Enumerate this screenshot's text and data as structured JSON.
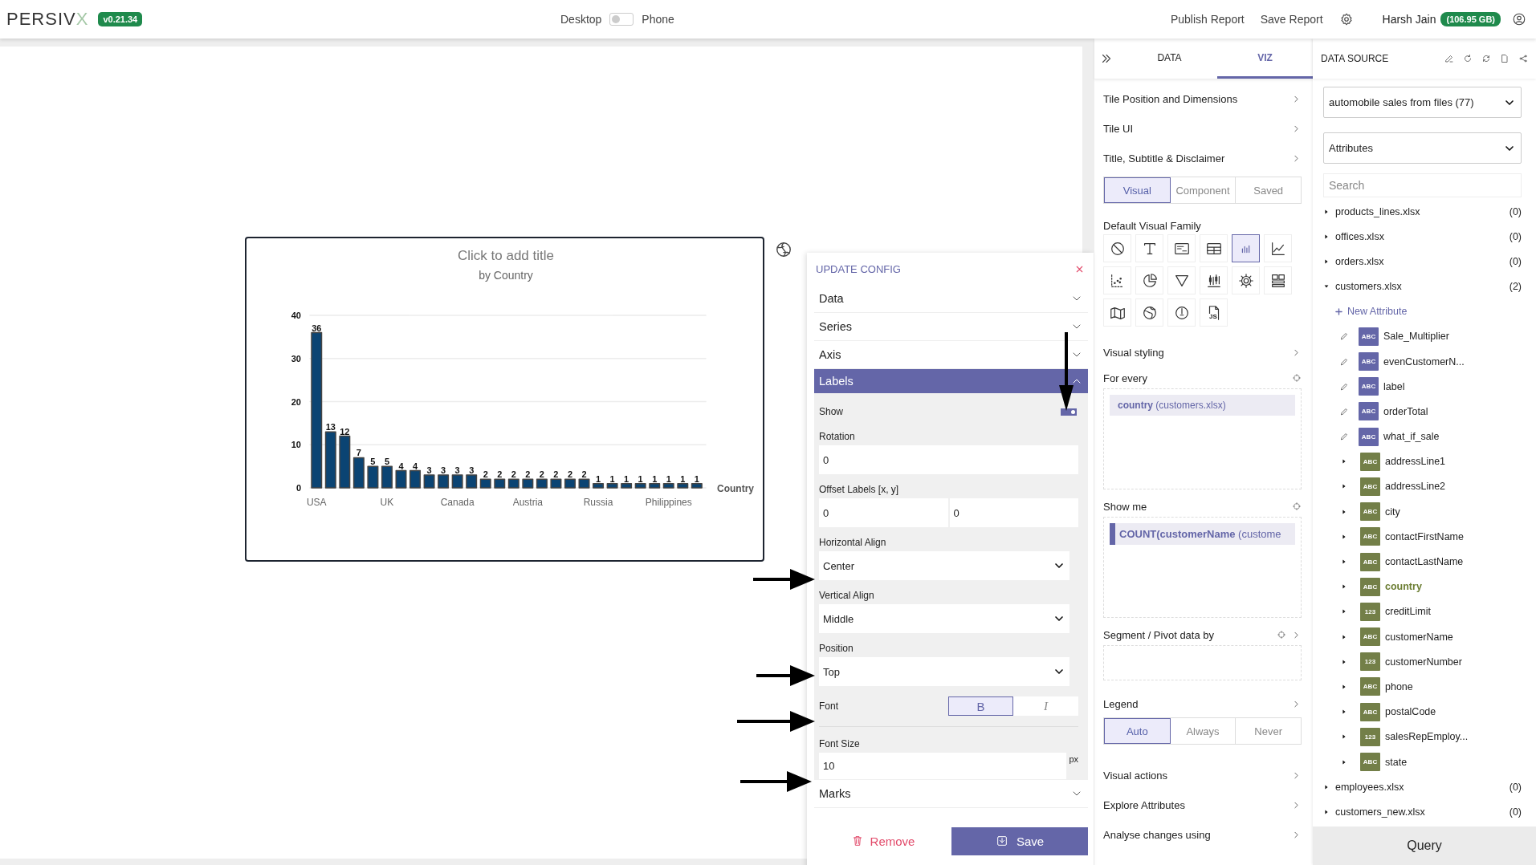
{
  "top_bar": {
    "logo": {
      "text": "PERSIV",
      "accent": "X"
    },
    "version": "v0.21.34",
    "view_toggle": {
      "left": "Desktop",
      "right": "Phone",
      "on": false
    },
    "actions": [
      "Publish Report",
      "Save Report"
    ],
    "user": {
      "name": "Harsh Jain",
      "storage": "(106.95 GB)"
    }
  },
  "tile": {
    "title": "Click to add title",
    "subtitle": "by Country",
    "chart_data": {
      "type": "bar",
      "xlabel": "Country",
      "categories": [
        "USA",
        null,
        null,
        null,
        null,
        "UK",
        null,
        null,
        null,
        null,
        "Canada",
        null,
        null,
        null,
        null,
        "Austria",
        null,
        null,
        null,
        null,
        "Russia",
        null,
        null,
        null,
        null,
        "Philippines",
        null,
        null
      ],
      "values": [
        36,
        13,
        12,
        7,
        5,
        5,
        4,
        4,
        3,
        3,
        3,
        3,
        2,
        2,
        2,
        2,
        2,
        2,
        2,
        2,
        1,
        1,
        1,
        1,
        1,
        1,
        1,
        1
      ],
      "grid": true,
      "ylim": [
        0,
        40
      ],
      "yticks": [
        0,
        10,
        20,
        30,
        40
      ],
      "data_labels": true
    }
  },
  "config": {
    "title": "UPDATE CONFIG",
    "sections": [
      {
        "label": "Data",
        "expanded": false
      },
      {
        "label": "Series",
        "expanded": false
      },
      {
        "label": "Axis",
        "expanded": false
      },
      {
        "label": "Labels",
        "expanded": true
      },
      {
        "label": "Marks",
        "expanded": false
      }
    ],
    "label_fields": [
      {
        "kind": "toggle",
        "label": "Show",
        "on": true
      },
      {
        "kind": "input",
        "label": "Rotation",
        "value": "0"
      },
      {
        "kind": "pair",
        "label": "Offset Labels [x, y]",
        "values": [
          "0",
          "0"
        ]
      },
      {
        "kind": "select",
        "label": "Horizontal Align",
        "value": "Center"
      },
      {
        "kind": "select",
        "label": "Vertical Align",
        "value": "Middle"
      },
      {
        "kind": "select",
        "label": "Position",
        "value": "Top"
      },
      {
        "kind": "style",
        "label": "Font",
        "options": [
          {
            "label": "B",
            "selected": true
          },
          {
            "label": "I",
            "selected": false
          }
        ]
      },
      {
        "kind": "size",
        "label": "Font Size",
        "value": "10",
        "unit": "px"
      }
    ],
    "remove": "Remove",
    "save": "Save"
  },
  "viz_panel": {
    "tabs": [
      {
        "label": "DATA",
        "selected": false
      },
      {
        "label": "VIZ",
        "selected": true
      }
    ],
    "links_top": [
      "Tile Position and Dimensions",
      "Tile UI",
      "Title, Subtitle & Disclaimer"
    ],
    "modes": [
      {
        "label": "Visual",
        "selected": true
      },
      {
        "label": "Component",
        "selected": false
      },
      {
        "label": "Saved",
        "selected": false
      }
    ],
    "family_label": "Default Visual Family",
    "family": [
      {
        "kind": "none",
        "selected": false
      },
      {
        "kind": "text",
        "selected": false
      },
      {
        "kind": "card",
        "selected": false
      },
      {
        "kind": "table",
        "selected": false
      },
      {
        "kind": "bar",
        "selected": true
      },
      {
        "kind": "line",
        "selected": false
      },
      {
        "kind": "scatter",
        "selected": false
      },
      {
        "kind": "pie",
        "selected": false
      },
      {
        "kind": "funnel",
        "selected": false
      },
      {
        "kind": "candle",
        "selected": false
      },
      {
        "kind": "gear",
        "selected": false
      },
      {
        "kind": "layout",
        "selected": false
      },
      {
        "kind": "map",
        "selected": false
      },
      {
        "kind": "globe",
        "selected": false
      },
      {
        "kind": "gauge",
        "selected": false
      },
      {
        "kind": "file",
        "selected": false,
        "label": "JS"
      }
    ],
    "styling": "Visual styling",
    "for_every": {
      "label": "For every",
      "chips": [
        "**country** (customers.xlsx)"
      ]
    },
    "show_me": {
      "label": "Show me",
      "chips": [
        "**COUNT(customerName** (custome"
      ]
    },
    "segment": {
      "label": "Segment / Pivot data by"
    },
    "legend": {
      "label": "Legend",
      "options": [
        {
          "label": "Auto",
          "selected": true
        },
        {
          "label": "Always",
          "selected": false
        },
        {
          "label": "Never",
          "selected": false
        }
      ]
    },
    "links_bottom": [
      "Visual actions",
      "Explore Attributes",
      "Analyse changes using"
    ]
  },
  "data_source": {
    "title": "DATA SOURCE",
    "dataset": "automobile sales from files (77)",
    "view": "Attributes",
    "search_placeholder": "Search",
    "files": [
      {
        "name": "products_lines.xlsx",
        "count": "(0)",
        "expanded": false
      },
      {
        "name": "offices.xlsx",
        "count": "(0)",
        "expanded": false
      },
      {
        "name": "orders.xlsx",
        "count": "(0)",
        "expanded": false
      },
      {
        "name": "customers.xlsx",
        "count": "(2)",
        "expanded": true,
        "new_attribute": "New Attribute",
        "children": [
          {
            "name": "Sale_Multiplier",
            "type": "ABC",
            "kind": "custom",
            "in_use": false
          },
          {
            "name": "evenCustomerN...",
            "type": "ABC",
            "kind": "custom",
            "in_use": false
          },
          {
            "name": "label",
            "type": "ABC",
            "kind": "custom",
            "in_use": false
          },
          {
            "name": "orderTotal",
            "type": "ABC",
            "kind": "custom",
            "in_use": false
          },
          {
            "name": "what_if_sale",
            "type": "ABC",
            "kind": "custom",
            "in_use": false
          },
          {
            "name": "addressLine1",
            "type": "ABC",
            "kind": "field",
            "in_use": false
          },
          {
            "name": "addressLine2",
            "type": "ABC",
            "kind": "field",
            "in_use": false
          },
          {
            "name": "city",
            "type": "ABC",
            "kind": "field",
            "in_use": false
          },
          {
            "name": "contactFirstName",
            "type": "ABC",
            "kind": "field",
            "in_use": false
          },
          {
            "name": "contactLastName",
            "type": "ABC",
            "kind": "field",
            "in_use": false
          },
          {
            "name": "country",
            "type": "ABC",
            "kind": "field",
            "in_use": true
          },
          {
            "name": "creditLimit",
            "type": "123",
            "kind": "field",
            "in_use": false
          },
          {
            "name": "customerName",
            "type": "ABC",
            "kind": "field",
            "in_use": false
          },
          {
            "name": "customerNumber",
            "type": "123",
            "kind": "field",
            "in_use": false
          },
          {
            "name": "phone",
            "type": "ABC",
            "kind": "field",
            "in_use": false
          },
          {
            "name": "postalCode",
            "type": "ABC",
            "kind": "field",
            "in_use": false
          },
          {
            "name": "salesRepEmploy...",
            "type": "123",
            "kind": "field",
            "in_use": false
          },
          {
            "name": "state",
            "type": "ABC",
            "kind": "field",
            "in_use": false
          }
        ]
      },
      {
        "name": "employees.xlsx",
        "count": "(0)",
        "expanded": false
      },
      {
        "name": "customers_new.xlsx",
        "count": "(0)",
        "expanded": false
      }
    ],
    "query": "Query"
  }
}
